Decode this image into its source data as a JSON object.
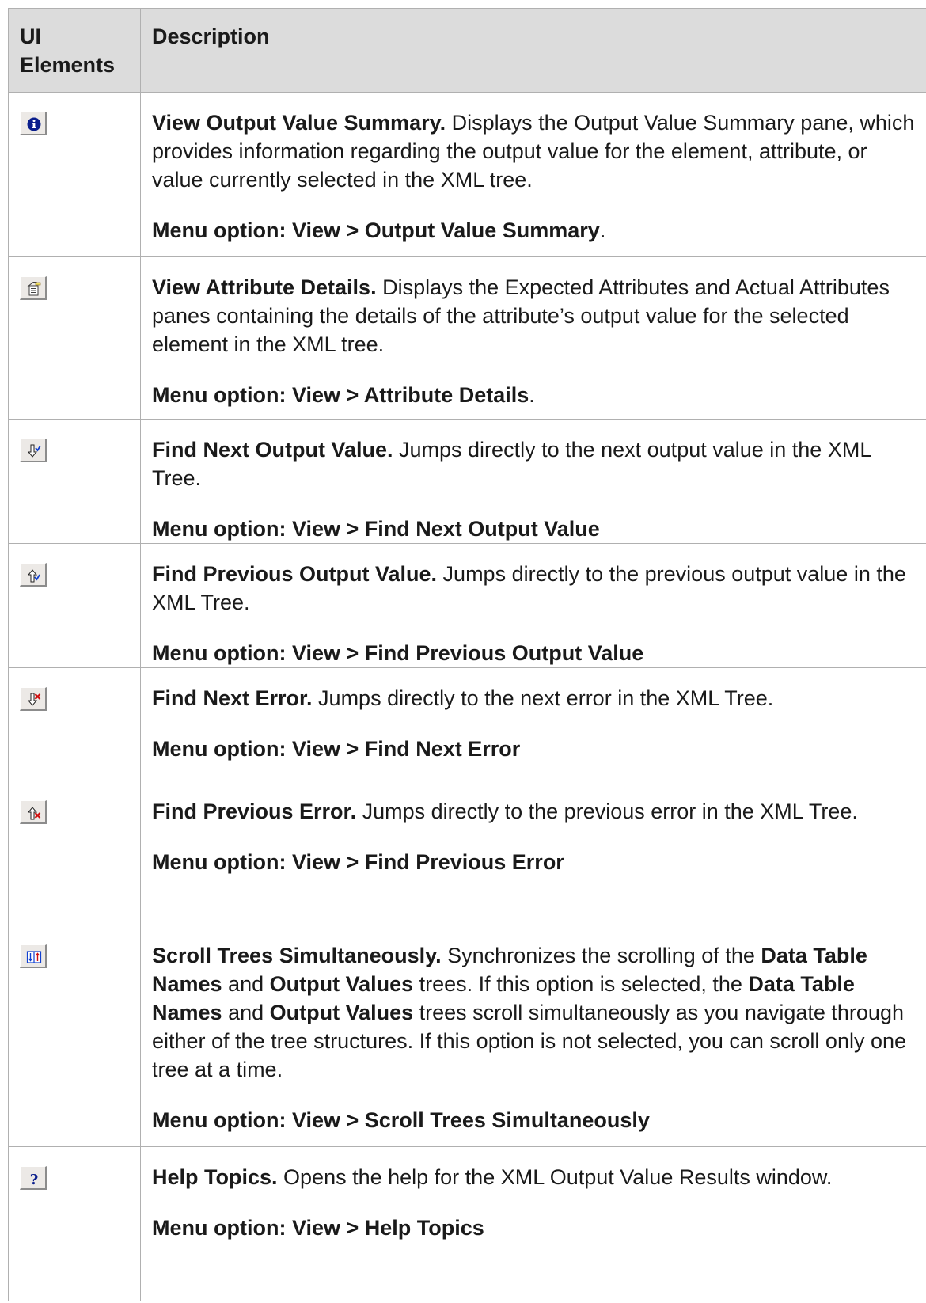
{
  "header": {
    "col1": "UI Elements",
    "col2": "Description"
  },
  "rows": [
    {
      "icon": "info-icon",
      "title": "View Output Value Summary.",
      "desc": " Displays the Output Value Summary pane, which provides information regarding the output value for the element, attribute, or value currently selected in the XML tree.",
      "menu": "Menu option: View > Output Value Summary",
      "menu_suffix": "."
    },
    {
      "icon": "attribute-details-icon",
      "title": "View Attribute Details.",
      "desc": " Displays the Expected Attributes and Actual Attributes panes containing the details of the attribute’s output value for the selected element in the XML tree.",
      "menu": "Menu option: View > Attribute Details",
      "menu_suffix": "."
    },
    {
      "icon": "find-next-output-icon",
      "title": "Find Next Output Value.",
      "desc": " Jumps directly to the next output value in the XML Tree.",
      "menu": "Menu option: View > Find Next Output Value",
      "menu_suffix": ""
    },
    {
      "icon": "find-previous-output-icon",
      "title": "Find Previous Output Value.",
      "desc": " Jumps directly to the previous output value in the XML Tree.",
      "menu": "Menu option: View > Find Previous Output Value",
      "menu_suffix": ""
    },
    {
      "icon": "find-next-error-icon",
      "title": "Find Next Error.",
      "desc": " Jumps directly to the next error in the XML Tree.",
      "menu": "Menu option: View > Find Next Error",
      "menu_suffix": ""
    },
    {
      "icon": "find-previous-error-icon",
      "title": "Find Previous Error.",
      "desc": " Jumps directly to the previous error in the XML Tree.",
      "menu": "Menu option: View > Find Previous Error",
      "menu_suffix": ""
    },
    {
      "icon": "scroll-simultaneously-icon",
      "title": "Scroll Trees Simultaneously.",
      "desc_parts": [
        {
          "text": " Synchronizes the scrolling of the ",
          "bold": false
        },
        {
          "text": "Data Table Names",
          "bold": true
        },
        {
          "text": " and ",
          "bold": false
        },
        {
          "text": "Output Values",
          "bold": true
        },
        {
          "text": " trees. If this option is selected, the ",
          "bold": false
        },
        {
          "text": "Data Table Names",
          "bold": true
        },
        {
          "text": " and ",
          "bold": false
        },
        {
          "text": "Output Values",
          "bold": true
        },
        {
          "text": " trees scroll simultaneously as you navigate through either of the tree structures. If this option is not selected, you can scroll only one tree at a time.",
          "bold": false
        }
      ],
      "menu": "Menu option: View > Scroll Trees Simultaneously",
      "menu_suffix": ""
    },
    {
      "icon": "help-icon",
      "title": "Help Topics.",
      "desc": " Opens the help for the XML Output Value Results window.",
      "menu": "Menu option: View > Help Topics",
      "menu_suffix": ""
    }
  ]
}
